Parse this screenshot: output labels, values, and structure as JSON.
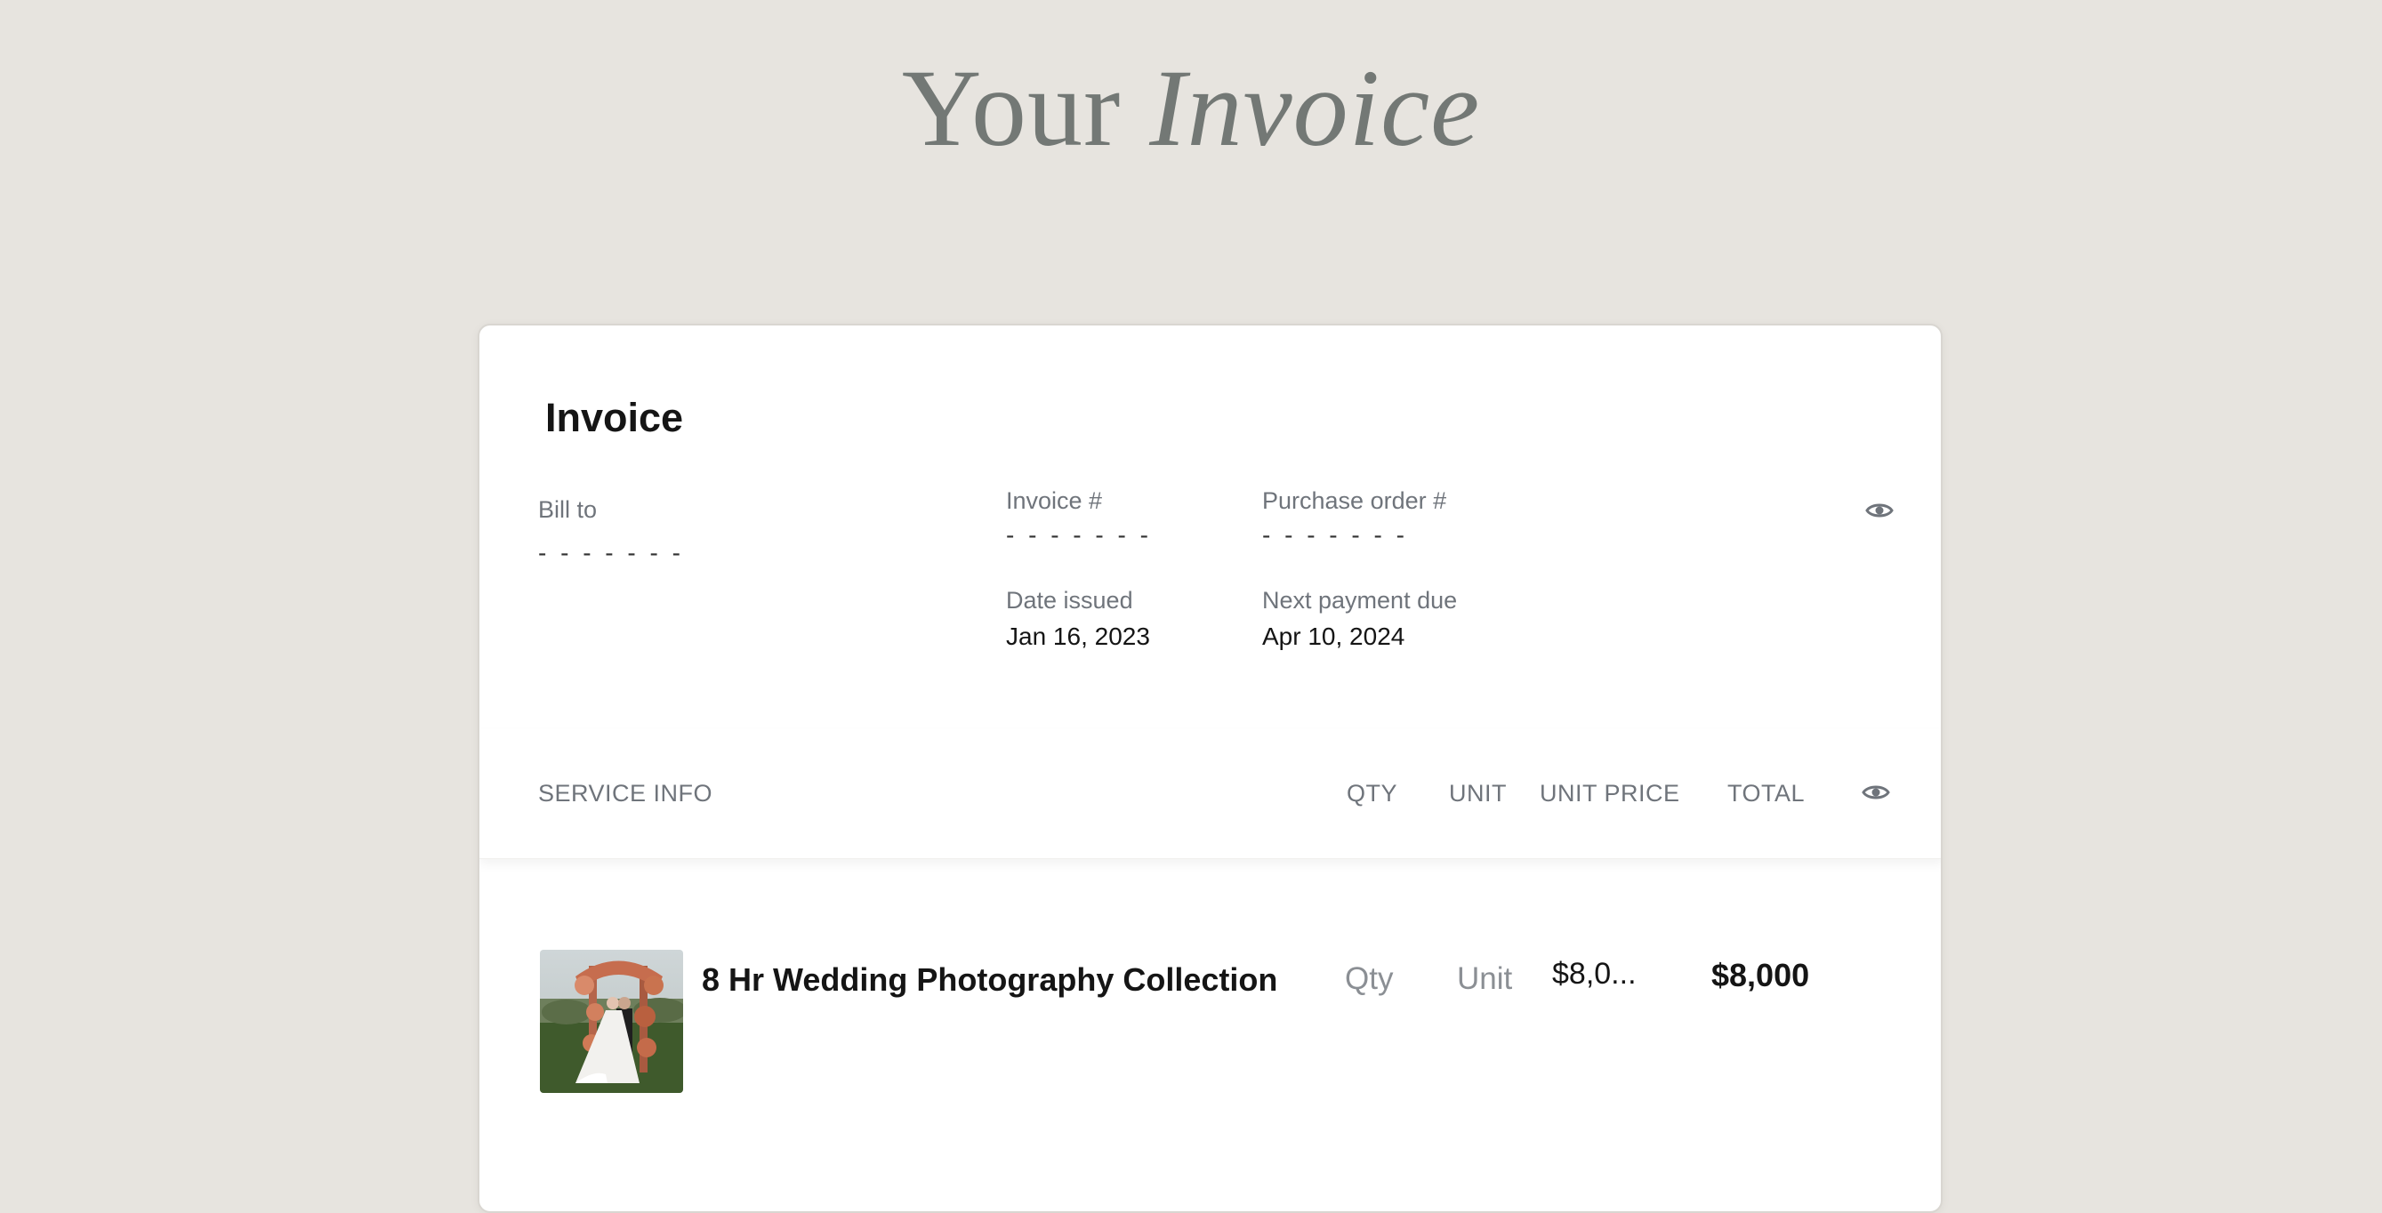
{
  "page": {
    "title_plain": "Your",
    "title_italic": "Invoice"
  },
  "invoice": {
    "heading": "Invoice",
    "bill_to_label": "Bill to",
    "bill_to_value": "- - - - - - -",
    "invoice_number_label": "Invoice #",
    "invoice_number_value": "- - - - - - -",
    "purchase_order_label": "Purchase order #",
    "purchase_order_value": "- - - - - - -",
    "date_issued_label": "Date issued",
    "date_issued_value": "Jan 16, 2023",
    "next_payment_label": "Next payment due",
    "next_payment_value": "Apr 10, 2024",
    "visibility_icon": "eye-icon"
  },
  "table": {
    "columns": {
      "service": "SERVICE INFO",
      "qty": "QTY",
      "unit": "UNIT",
      "unit_price": "UNIT PRICE",
      "total": "TOTAL"
    },
    "visibility_icon": "eye-icon",
    "rows": [
      {
        "name": "8 Hr Wedding Photography Collection",
        "qty_placeholder": "Qty",
        "unit_placeholder": "Unit",
        "unit_price": "$8,0...",
        "total": "$8,000",
        "thumbnail": "wedding-photo"
      }
    ]
  },
  "colors": {
    "background": "#e7e4df",
    "title": "#737875",
    "muted_text": "#6f747b",
    "text": "#151515"
  }
}
